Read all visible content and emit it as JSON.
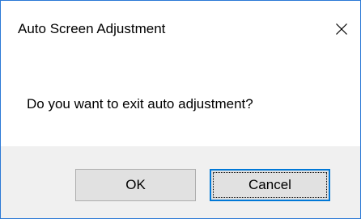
{
  "dialog": {
    "title": "Auto Screen Adjustment",
    "message": "Do you want to exit auto adjustment?",
    "close_icon": "close-icon",
    "ok_label": "OK",
    "cancel_label": "Cancel"
  },
  "colors": {
    "window_border": "#2b79d6",
    "footer_background": "#f0f0f0",
    "button_background": "#e1e1e1",
    "focus_accent": "#0078d7"
  }
}
